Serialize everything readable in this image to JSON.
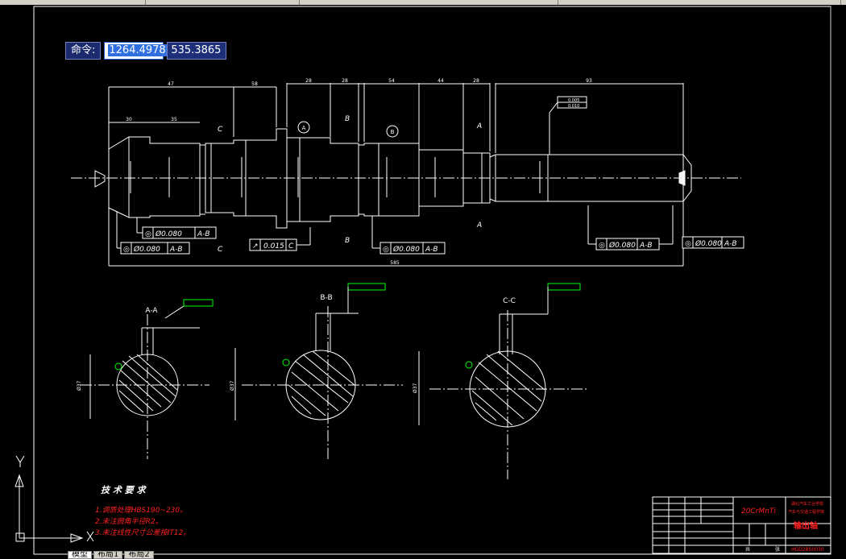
{
  "command_bar": {
    "label": "命令:",
    "x_value": "1264.4978",
    "y_value": "535.3865"
  },
  "drawing": {
    "dims_top": [
      "47",
      "58",
      "28",
      "54",
      "44",
      "28",
      "93"
    ],
    "dim_sub": [
      "30",
      "35"
    ],
    "overall_length": "585",
    "section_labels": {
      "c_top": "C",
      "c_bottom": "C",
      "b_top": "B",
      "b_bottom": "B",
      "a_top": "A",
      "a_bottom": "A",
      "datum_a": "A",
      "datum_b": "B"
    },
    "tolerance_boxes": [
      {
        "sym": "◎",
        "val": "Ø0.080",
        "ref": "A-B"
      },
      {
        "sym": "◎",
        "val": "Ø0.080",
        "ref": "A-B"
      },
      {
        "sym": "↗",
        "val": "0.015",
        "ref": "C"
      },
      {
        "sym": "◎",
        "val": "Ø0.080",
        "ref": "A-B"
      },
      {
        "sym": "◎",
        "val": "Ø0.080",
        "ref": "A-B"
      },
      {
        "sym": "◎",
        "val": "Ø0.080",
        "ref": "A-B"
      }
    ],
    "flatness_top": [
      "0.005",
      "0.010"
    ],
    "sections": [
      {
        "title": "A-A",
        "dia": "Ø37"
      },
      {
        "title": "B-B",
        "dia": "Ø37"
      },
      {
        "title": "C-C",
        "dia": "Ø37"
      }
    ]
  },
  "tech_requirements": {
    "title": "技 术 要 求",
    "items": [
      "1.调质处理HBS190~230。",
      "2.未注圆角半径R2。",
      "3.未注线性尺寸公差按IT12。"
    ]
  },
  "title_block": {
    "material": "20CrMnTi",
    "school_line1": "湖北汽车工业学院",
    "school_line2": "汽车与交通工程学院",
    "part_name": "输出轴",
    "drawing_no": "HGD2BS0030",
    "scale_label": "共",
    "sheet_label": "张"
  },
  "layout_tabs": [
    {
      "label": "模型"
    },
    {
      "label": "布局1"
    },
    {
      "label": "布局2"
    }
  ]
}
